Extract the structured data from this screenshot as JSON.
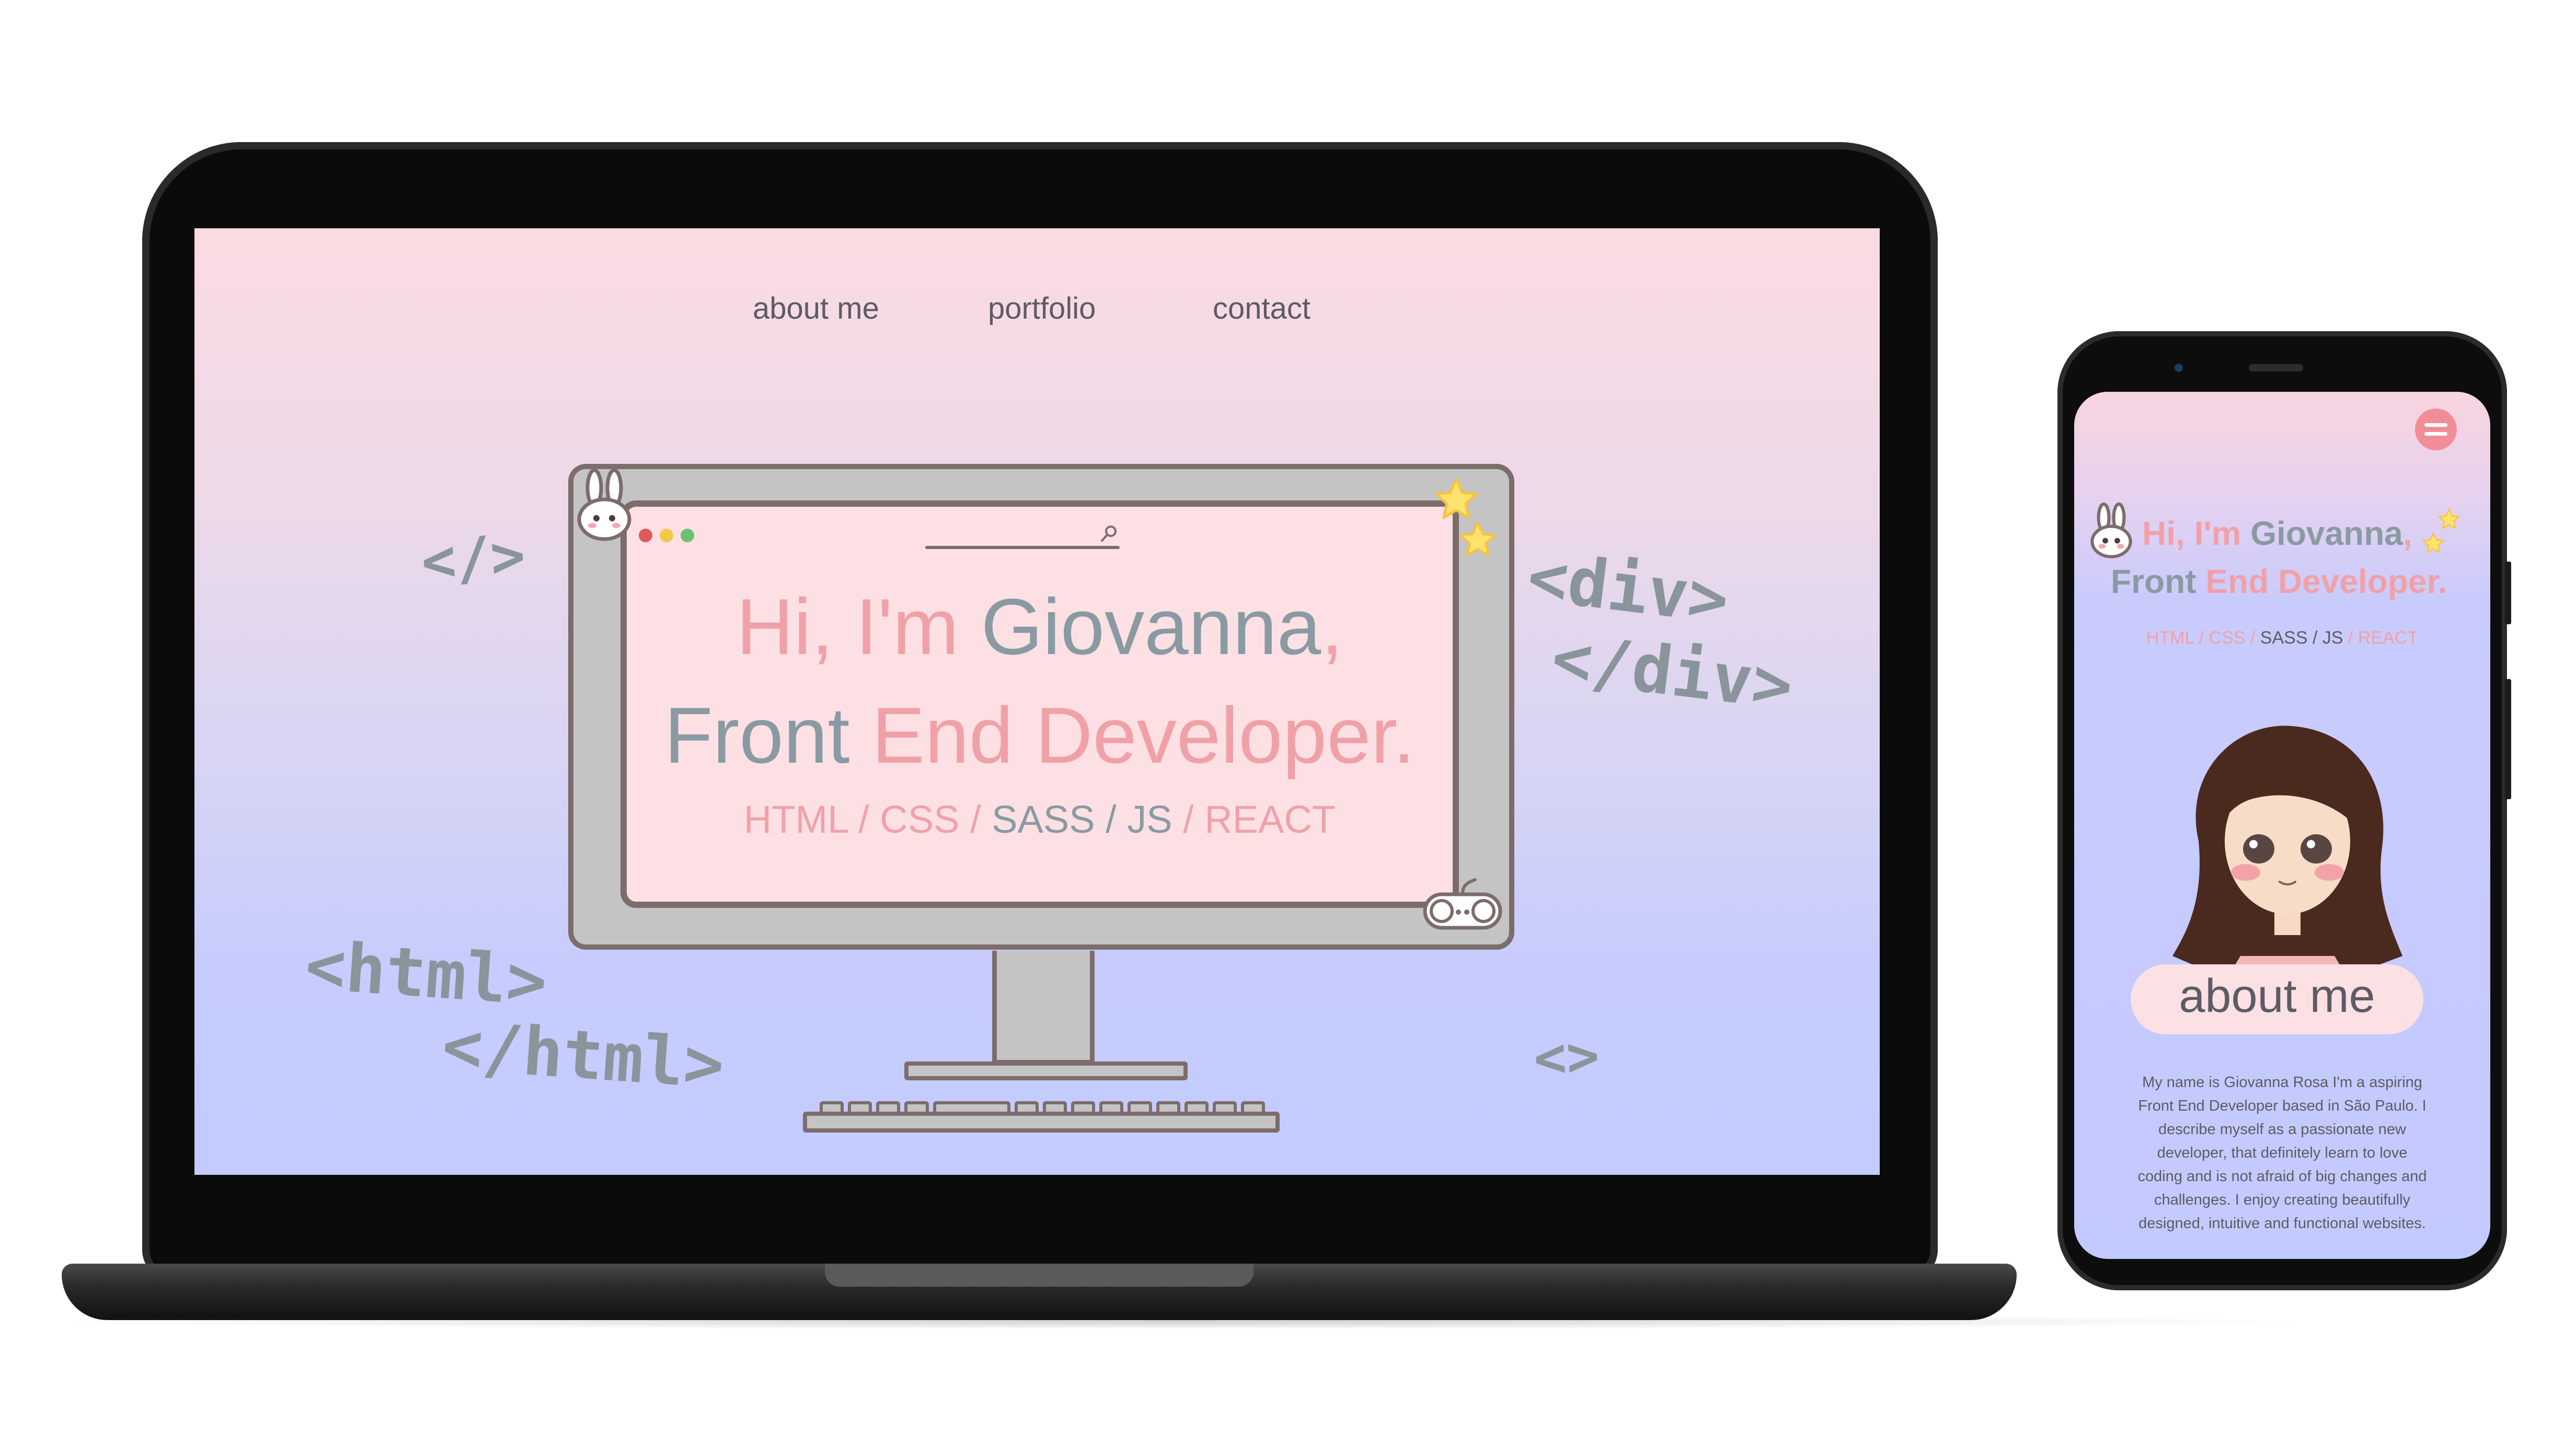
{
  "colors": {
    "accent_pink": "#f0a1a8",
    "accent_gray": "#8a9aa2",
    "nav_text": "#5d5b63",
    "illustration_outline": "#7d6c6c",
    "gradient_top": "#fadbe2",
    "gradient_bottom": "#c3cbff"
  },
  "desktop": {
    "nav": {
      "about": "about me",
      "portfolio": "portfolio",
      "contact": "contact"
    },
    "decorations": {
      "closing_tag": "</>",
      "div_open": "<div>",
      "div_close": "</div>",
      "html_open": "<html>",
      "html_close": "</html>",
      "empty_tag": "<>"
    },
    "hero": {
      "greeting": "Hi, I'm",
      "name": "Giovanna",
      "comma": ",",
      "role_prefix": "Front",
      "role_highlight": "End Developer.",
      "skills": {
        "html": "HTML",
        "css": "CSS",
        "sass": "SASS",
        "js": "JS",
        "react": "REACT",
        "separator": " / "
      }
    },
    "icons": [
      "bunny-icon",
      "star-icon",
      "search-icon",
      "gamepad-icon"
    ]
  },
  "mobile": {
    "menu_icon": "hamburger-menu-icon",
    "hero": {
      "greeting": "Hi, I'm",
      "name": "Giovanna",
      "comma": ",",
      "role_prefix": "Front",
      "role_highlight": "End Developer.",
      "skills": {
        "html": "HTML",
        "css": "CSS",
        "sass": "SASS",
        "js": "JS",
        "react": "REACT",
        "separator": " / "
      }
    },
    "about": {
      "title": "about me",
      "bio_lines": [
        "My name is Giovanna Rosa I'm a aspiring",
        "Front End Developer based in São Paulo. I",
        "describe myself as a passionate new",
        "developer, that definitely learn to love",
        "coding and is not afraid of big changes and",
        "challenges. I enjoy creating beautifully",
        "designed, intuitive and functional websites."
      ]
    }
  }
}
